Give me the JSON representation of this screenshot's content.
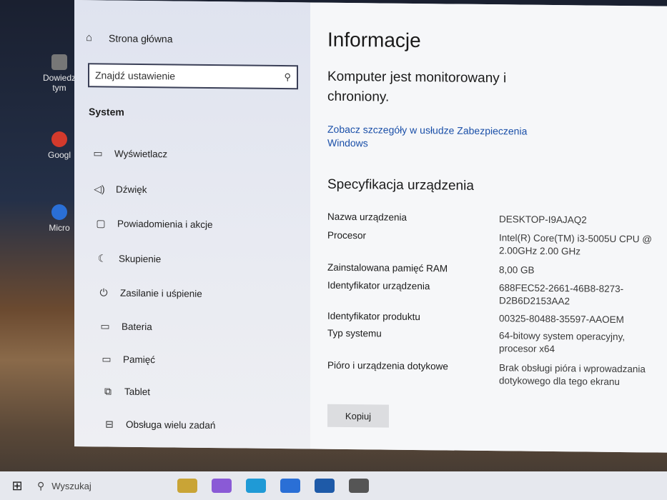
{
  "desktop": {
    "icons": [
      {
        "label": "Dowiedz\ntym",
        "color": "#777777"
      },
      {
        "label": "Googl",
        "color": "#d33a2c"
      },
      {
        "label": "Micro",
        "color": "#2a6fd6"
      }
    ]
  },
  "nav": {
    "home_label": "Strona główna",
    "search_placeholder": "Znajdź ustawienie",
    "section_title": "System",
    "items": [
      {
        "label": "Wyświetlacz",
        "icon": "monitor-icon",
        "glyph": "▭"
      },
      {
        "label": "Dźwięk",
        "icon": "speaker-icon",
        "glyph": "🔈"
      },
      {
        "label": "Powiadomienia i akcje",
        "icon": "notification-icon",
        "glyph": "▢"
      },
      {
        "label": "Skupienie",
        "icon": "moon-icon",
        "glyph": "☾"
      },
      {
        "label": "Zasilanie i uśpienie",
        "icon": "power-icon",
        "glyph": "⏻"
      },
      {
        "label": "Bateria",
        "icon": "battery-icon",
        "glyph": "▭"
      },
      {
        "label": "Pamięć",
        "icon": "storage-icon",
        "glyph": "▭"
      },
      {
        "label": "Tablet",
        "icon": "tablet-icon",
        "glyph": "⧉"
      },
      {
        "label": "Obsługa wielu zadań",
        "icon": "multitasking-icon",
        "glyph": "⊟"
      }
    ]
  },
  "content": {
    "title": "Informacje",
    "status": "Komputer jest monitorowany i chroniony.",
    "security_link": "Zobacz szczegóły w usłudze Zabezpieczenia Windows",
    "spec_title": "Specyfikacja urządzenia",
    "specs": [
      {
        "label": "Nazwa urządzenia",
        "value": "DESKTOP-I9AJAQ2"
      },
      {
        "label": "Procesor",
        "value": "Intel(R) Core(TM) i3-5005U CPU @ 2.00GHz   2.00 GHz"
      },
      {
        "label": "Zainstalowana pamięć RAM",
        "value": "8,00 GB"
      },
      {
        "label": "Identyfikator urządzenia",
        "value": "688FEC52-2661-46B8-8273-D2B6D2153AA2"
      },
      {
        "label": "Identyfikator produktu",
        "value": "00325-80488-35597-AAOEM"
      },
      {
        "label": "Typ systemu",
        "value": "64-bitowy system operacyjny, procesor x64"
      },
      {
        "label": "Pióro i urządzenia dotykowe",
        "value": "Brak obsługi pióra i wprowadzania dotykowego dla tego ekranu"
      }
    ],
    "copy_label": "Kopiuj"
  },
  "taskbar": {
    "search_label": "Wyszukaj",
    "apps": [
      {
        "icon": "file-explorer-icon",
        "color": "#c9a436"
      },
      {
        "icon": "copilot-icon",
        "color": "#8a5ad6"
      },
      {
        "icon": "edge-icon",
        "color": "#1f9ad6"
      },
      {
        "icon": "store-icon",
        "color": "#2a6fd6"
      },
      {
        "icon": "mail-icon",
        "color": "#1e5aa8"
      },
      {
        "icon": "settings-icon",
        "color": "#555555"
      }
    ]
  }
}
